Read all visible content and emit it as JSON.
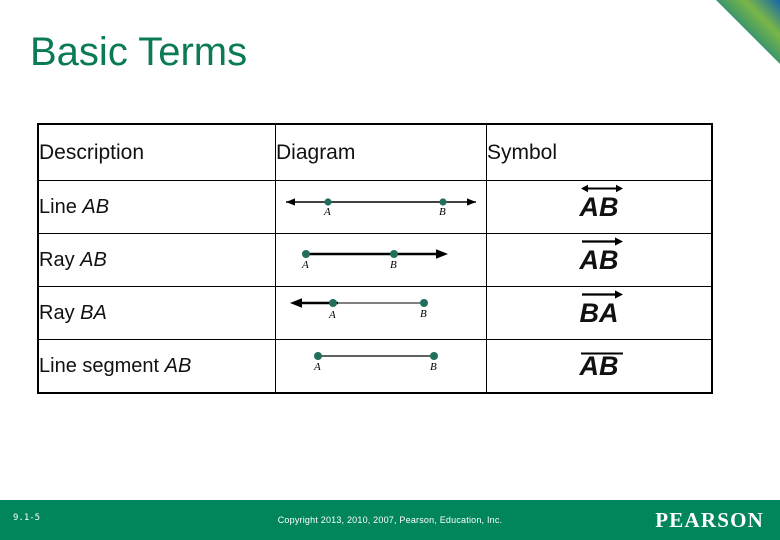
{
  "slide": {
    "title": "Basic Terms"
  },
  "table": {
    "headers": [
      "Description",
      "Diagram",
      "Symbol"
    ],
    "rows": [
      {
        "description_prefix": "Line ",
        "description_italic": "AB",
        "description_full": "Line AB",
        "diagram_type": "line",
        "diagram_labels": [
          "A",
          "B"
        ],
        "symbol_text": "AB",
        "symbol_overmark": "double-arrow"
      },
      {
        "description_prefix": "Ray ",
        "description_italic": "AB",
        "description_full": "Ray AB",
        "diagram_type": "ray-right",
        "diagram_labels": [
          "A",
          "B"
        ],
        "symbol_text": "AB",
        "symbol_overmark": "right-arrow"
      },
      {
        "description_prefix": "Ray ",
        "description_italic": "BA",
        "description_full": "Ray BA",
        "diagram_type": "ray-left",
        "diagram_labels": [
          "A",
          "B"
        ],
        "symbol_text": "BA",
        "symbol_overmark": "right-arrow"
      },
      {
        "description_prefix": "Line segment ",
        "description_italic": "AB",
        "description_full": "Line segment AB",
        "diagram_type": "segment",
        "diagram_labels": [
          "A",
          "B"
        ],
        "symbol_text": "AB",
        "symbol_overmark": "bar"
      }
    ]
  },
  "footer": {
    "slide_number": "9.1-5",
    "copyright": "Copyright 2013, 2010, 2007, Pearson, Education, Inc.",
    "brand": "PEARSON"
  },
  "colors": {
    "title_green": "#0a7b55",
    "header_teal": "#7fc7ab",
    "footer_green": "#00855c",
    "point_dot": "#1f6f5c",
    "line_black": "#000000",
    "corner_blue": "#1466a8",
    "corner_green": "#7ab648"
  }
}
